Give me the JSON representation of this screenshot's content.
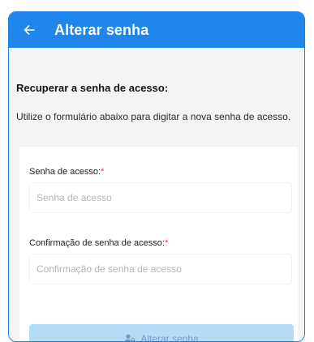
{
  "appbar": {
    "title": "Alterar senha",
    "back_icon": "arrow-left-icon",
    "background": "#1f86ea"
  },
  "section": {
    "title": "Recuperar a senha de acesso:",
    "description": "Utilize o formulário abaixo para digitar a nova senha de acesso."
  },
  "form": {
    "password": {
      "label": "Senha de acesso:",
      "required_mark": "*",
      "placeholder": "Senha de acesso",
      "value": ""
    },
    "confirm": {
      "label": "Confirmação de senha de acesso:",
      "required_mark": "*",
      "placeholder": "Confirmação de senha de acesso",
      "value": ""
    },
    "submit": {
      "label": "Alterar senha",
      "icon": "user-lock-icon",
      "background": "#b5dcf7"
    }
  },
  "colors": {
    "primary": "#1f86ea",
    "required": "#e53935",
    "page_background": "#f3f4f6"
  }
}
